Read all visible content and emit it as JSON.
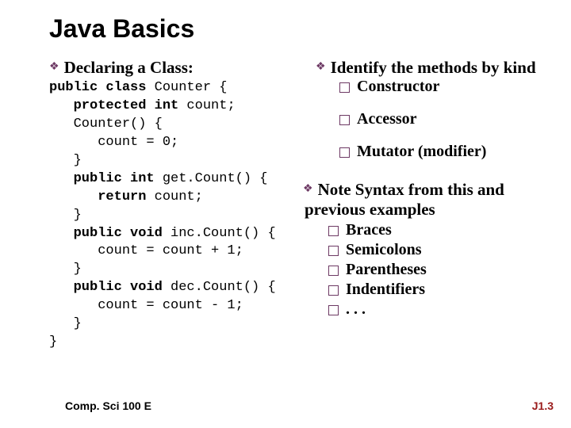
{
  "title": "Java Basics",
  "left": {
    "heading": "Declaring a Class:",
    "code_lines": [
      {
        "t": "public class Counter {",
        "keyword_prefix": "public class"
      },
      {
        "t": "   protected int count;",
        "keyword_prefix": "   protected int"
      },
      {
        "t": "   Counter() {"
      },
      {
        "t": "      count = 0;"
      },
      {
        "t": "   }"
      },
      {
        "t": "   public int get.Count() {",
        "keyword_prefix": "   public int"
      },
      {
        "t": "      return count;",
        "keyword_prefix": "      return"
      },
      {
        "t": "   }"
      },
      {
        "t": "   public void inc.Count() {",
        "keyword_prefix": "   public void"
      },
      {
        "t": "      count = count + 1;"
      },
      {
        "t": "   }"
      },
      {
        "t": "   public void dec.Count() {",
        "keyword_prefix": "   public void"
      },
      {
        "t": "      count = count - 1;"
      },
      {
        "t": "   }"
      },
      {
        "t": "}"
      }
    ]
  },
  "right": {
    "heading": "Identify the methods by kind",
    "kinds": [
      "Constructor",
      "Accessor",
      "Mutator (modifier)"
    ],
    "note_heading_line1": "Note Syntax from this and",
    "note_heading_line2": "previous examples",
    "syntax_items": [
      "Braces",
      "Semicolons",
      "Parentheses",
      "Indentifiers",
      ". . ."
    ]
  },
  "footer": {
    "left": "Comp. Sci 100 E",
    "right": "J1.3"
  },
  "colors": {
    "accent": "#6d3964",
    "footer_right": "#9a1b1b"
  }
}
